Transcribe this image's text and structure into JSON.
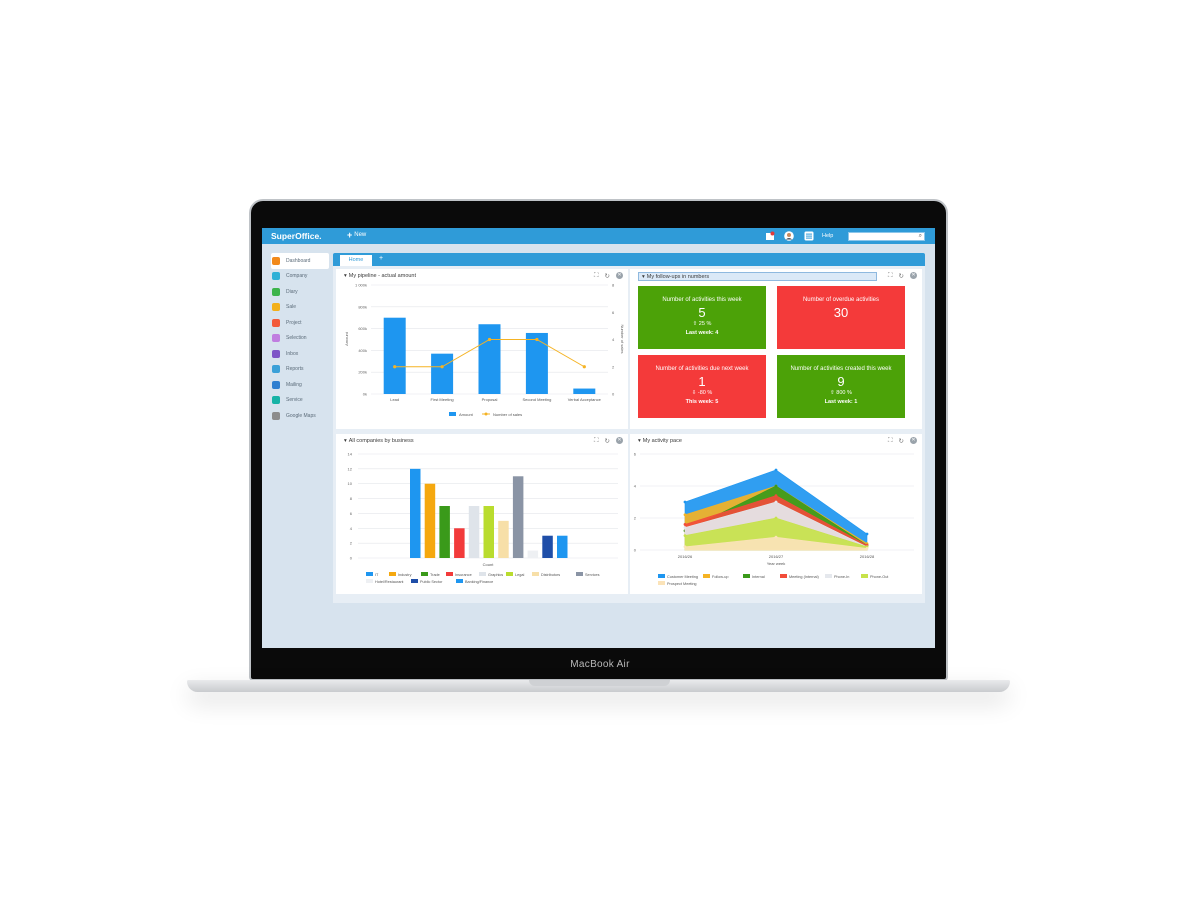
{
  "device": {
    "label": "MacBook Air"
  },
  "app": {
    "logo": "SuperOffice.",
    "new_label": "New",
    "help_label": "Help",
    "search_placeholder": ""
  },
  "sidebar": {
    "items": [
      {
        "label": "Dashboard",
        "color": "#f28a1b",
        "active": true
      },
      {
        "label": "Company",
        "color": "#2fb0d6"
      },
      {
        "label": "Diary",
        "color": "#3cb44b"
      },
      {
        "label": "Sale",
        "color": "#f2b01b"
      },
      {
        "label": "Project",
        "color": "#f25a3a"
      },
      {
        "label": "Selection",
        "color": "#c07ee0"
      },
      {
        "label": "Inbox",
        "color": "#7d55c7"
      },
      {
        "label": "Reports",
        "color": "#3aa0d8"
      },
      {
        "label": "Mailing",
        "color": "#2f7fd0"
      },
      {
        "label": "Service",
        "color": "#17b3a6"
      },
      {
        "label": "Google Maps",
        "color": "#8c8c8c"
      }
    ]
  },
  "tabs": {
    "home": "Home",
    "add": "+"
  },
  "panels": {
    "pipeline": {
      "title": "My pipeline - actual amount"
    },
    "followups": {
      "title": "My follow-ups in numbers"
    },
    "companies": {
      "title": "All companies by business"
    },
    "activity": {
      "title": "My activity pace"
    }
  },
  "tiles": [
    {
      "title": "Number of activities this week",
      "value": "5",
      "change": "⇧ 25 %",
      "footer": "Last week: 4",
      "color": "green"
    },
    {
      "title": "Number of overdue activities",
      "value": "30",
      "change": "",
      "footer": "",
      "color": "red"
    },
    {
      "title": "Number of activities due next week",
      "value": "1",
      "change": "⇩ -80 %",
      "footer": "This week: 5",
      "color": "red"
    },
    {
      "title": "Number of activities created this week",
      "value": "9",
      "change": "⇧ 800 %",
      "footer": "Last week: 1",
      "color": "green"
    }
  ],
  "chart_data": [
    {
      "type": "bar",
      "title": "My pipeline - actual amount",
      "categories": [
        "Lead",
        "First Meeting",
        "Proposal",
        "Second Meeting",
        "Verbal Acceptance"
      ],
      "series": [
        {
          "name": "Amount",
          "type": "bar",
          "color": "#1e96f0",
          "values": [
            700000,
            370000,
            640000,
            560000,
            50000
          ]
        },
        {
          "name": "Number of sales",
          "type": "line",
          "axis": "right",
          "color": "#f5b324",
          "values": [
            2,
            2,
            4,
            4,
            2
          ]
        }
      ],
      "ylabel": "Amount",
      "y2label": "Number of sales",
      "yticks": [
        "0k",
        "200k",
        "400k",
        "600k",
        "800k",
        "1 000k"
      ],
      "ylim": [
        0,
        1000000
      ],
      "y2ticks": [
        "0",
        "2",
        "4",
        "6",
        "8"
      ],
      "y2lim": [
        0,
        8
      ],
      "grid": true,
      "legend": "bottom"
    },
    {
      "type": "bar",
      "title": "All companies by business",
      "xlabel": "Count",
      "yticks": [
        "0",
        "2",
        "4",
        "6",
        "8",
        "10",
        "12",
        "14"
      ],
      "ylim": [
        0,
        14
      ],
      "series": [
        {
          "name": "IT",
          "color": "#1e96f0",
          "value": 12
        },
        {
          "name": "Industry",
          "color": "#f5a80f",
          "value": 10
        },
        {
          "name": "Trade",
          "color": "#3a9a1a",
          "value": 7
        },
        {
          "name": "Insurance",
          "color": "#f23a3a",
          "value": 4
        },
        {
          "name": "Graphics",
          "color": "#dfe4ea",
          "value": 7
        },
        {
          "name": "Legal",
          "color": "#b9dc2e",
          "value": 7
        },
        {
          "name": "Distributors",
          "color": "#f7dfa8",
          "value": 5
        },
        {
          "name": "Services",
          "color": "#8a94a5",
          "value": 11
        },
        {
          "name": "Hotel/Restaurant",
          "color": "#eef0f3",
          "value": 1
        },
        {
          "name": "Public Sector",
          "color": "#1f4ea8",
          "value": 3
        },
        {
          "name": "Banking/Finance",
          "color": "#1e96f0",
          "value": 3
        }
      ],
      "grid": true,
      "legend": "bottom"
    },
    {
      "type": "area",
      "title": "My activity pace",
      "xlabel": "Year week",
      "categories": [
        "2016/26",
        "2016/27",
        "2016/28"
      ],
      "yticks": [
        "0",
        "2",
        "4",
        "6"
      ],
      "ylim": [
        0,
        6
      ],
      "series": [
        {
          "name": "Customer Meeting",
          "color": "#1e96f0",
          "values": [
            3,
            5,
            1
          ]
        },
        {
          "name": "Follow-up",
          "color": "#f5b324",
          "values": [
            2.2,
            4,
            0.4
          ]
        },
        {
          "name": "Internal",
          "color": "#3a9a1a",
          "values": [
            1.2,
            4,
            0.3
          ]
        },
        {
          "name": "Meeting (Internal)",
          "color": "#f24c3a",
          "values": [
            1.6,
            3.4,
            0.3
          ]
        },
        {
          "name": "Phone-In",
          "color": "#e5e8ed",
          "values": [
            1.4,
            3,
            0.2
          ]
        },
        {
          "name": "Phone-Out",
          "color": "#c7e24a",
          "values": [
            0.9,
            2,
            0.2
          ]
        },
        {
          "name": "Prospect Meeting",
          "color": "#fbe3b8",
          "values": [
            0.2,
            0.8,
            0.1
          ]
        }
      ],
      "grid": true,
      "legend": "bottom"
    }
  ]
}
